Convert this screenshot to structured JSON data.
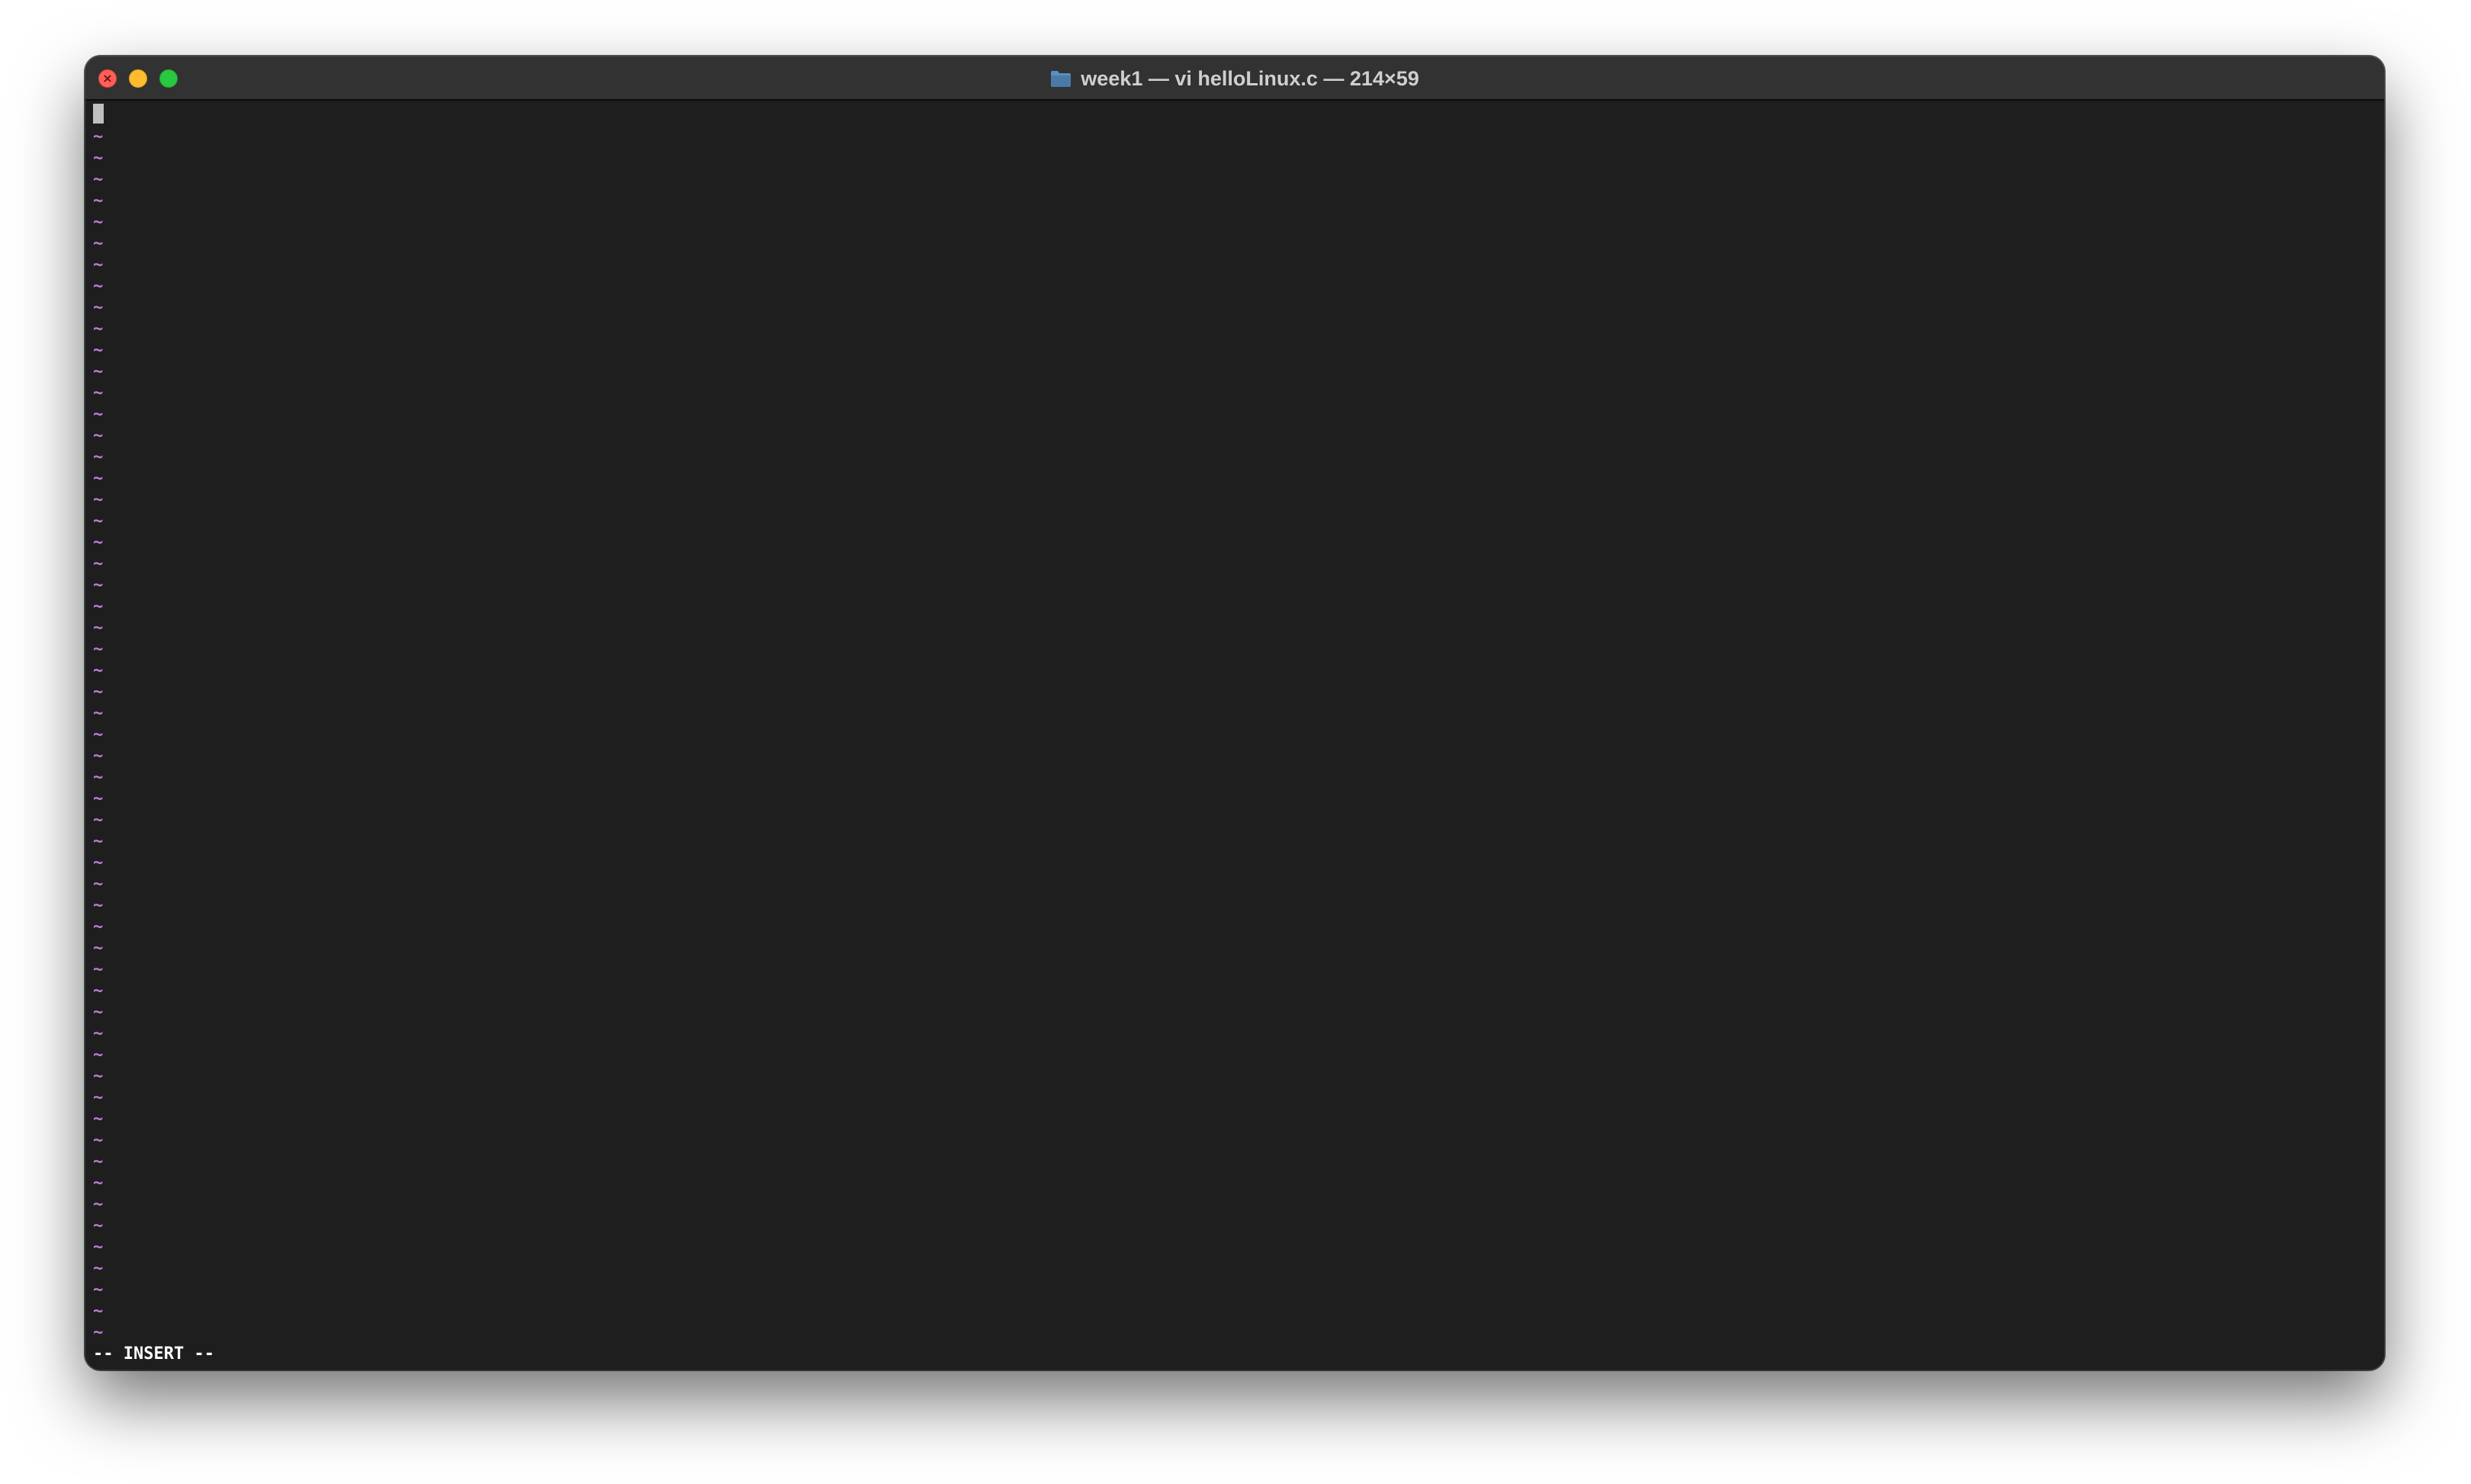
{
  "window": {
    "title": "week1 — vi helloLinux.c — 214×59",
    "folder_icon": "folder-icon",
    "controls": [
      {
        "name": "close-button",
        "color": "#ff5f57",
        "glyph": "×"
      },
      {
        "name": "minimize-button",
        "color": "#febc2e",
        "glyph": ""
      },
      {
        "name": "zoom-button",
        "color": "#28c840",
        "glyph": ""
      }
    ]
  },
  "editor": {
    "cursor_color": "#bfbfbf",
    "empty_line_marker": "~",
    "empty_line_color": "#c678dd",
    "empty_line_count": 57,
    "status_line": "-- INSERT --"
  },
  "colors": {
    "terminal_bg": "#1e1e1e",
    "titlebar_bg": "#323232",
    "title_text": "#cfcfcf"
  }
}
